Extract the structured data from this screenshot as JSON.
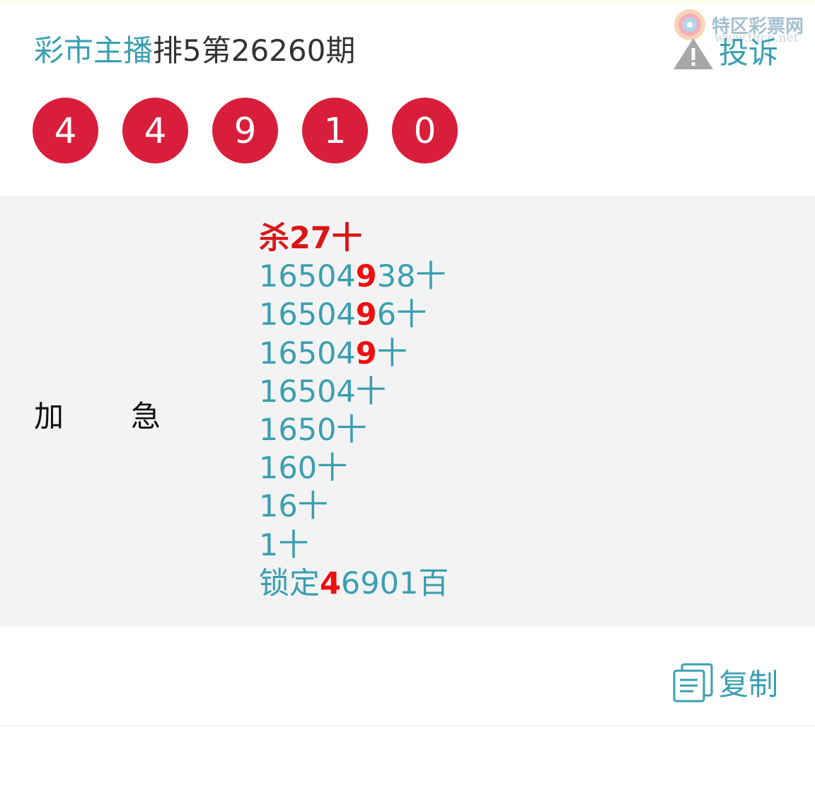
{
  "header": {
    "host": "彩市主播",
    "issue": "排5第26260期"
  },
  "brand": {
    "name": "特区彩票网",
    "url": "www.tqcp.net",
    "logo_icon": "swirl-logo-icon"
  },
  "complain": {
    "label": "投诉",
    "icon": "warning-triangle-icon"
  },
  "balls": [
    "4",
    "4",
    "9",
    "1",
    "0"
  ],
  "labels": {
    "left": "加",
    "right": "急"
  },
  "lines": [
    {
      "text": "杀27十",
      "kind": "kill"
    },
    {
      "pre": "16504",
      "hl": "9",
      "post": "38十"
    },
    {
      "pre": "16504",
      "hl": "9",
      "post": "6十"
    },
    {
      "pre": "16504",
      "hl": "9",
      "post": "十"
    },
    {
      "pre": "16504十",
      "hl": "",
      "post": ""
    },
    {
      "pre": "1650十",
      "hl": "",
      "post": ""
    },
    {
      "pre": "160十",
      "hl": "",
      "post": ""
    },
    {
      "pre": "16十",
      "hl": "",
      "post": ""
    },
    {
      "pre": "1十",
      "hl": "",
      "post": ""
    },
    {
      "pre": "锁定",
      "hl": "4",
      "post": "6901百"
    }
  ],
  "copy": {
    "label": "复制",
    "icon": "document-copy-icon"
  },
  "colors": {
    "accent": "#3a9fb1",
    "ball": "#d91e3b",
    "highlight": "#ee0f10",
    "panel": "#f3f3f3"
  }
}
